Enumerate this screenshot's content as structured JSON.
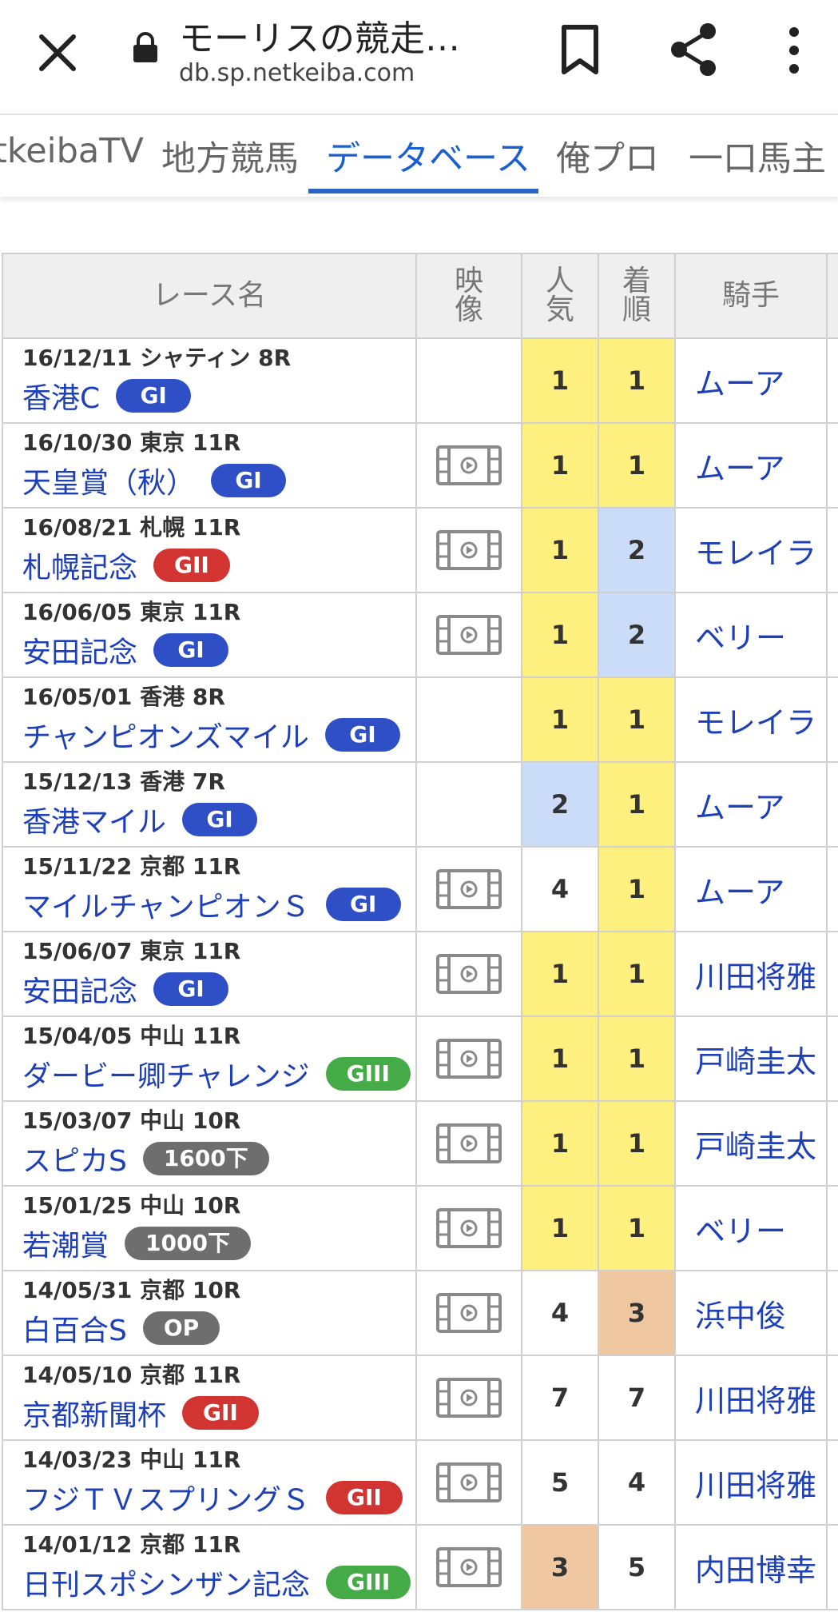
{
  "header": {
    "title": "モーリスの競走…",
    "url": "db.sp.netkeiba.com",
    "close_icon": "close-icon",
    "lock_icon": "lock-icon",
    "bookmark_icon": "bookmark-icon",
    "share_icon": "share-icon",
    "more_icon": "more-vert-icon"
  },
  "nav": {
    "tabs": [
      {
        "label": "tkeibaTV",
        "active": false
      },
      {
        "label": "地方競馬",
        "active": false
      },
      {
        "label": "データベース",
        "active": true
      },
      {
        "label": "俺プロ",
        "active": false
      },
      {
        "label": "一口馬主",
        "active": false
      }
    ]
  },
  "colors": {
    "link": "#1d3fb8",
    "tab_active": "#1a5fd0",
    "rank1_bg": "#fef07f",
    "rank2_bg": "#cbdcf8",
    "rank3_bg": "#efc8a2",
    "grade_GI": "#2f4fc7",
    "grade_GII": "#d23431",
    "grade_GIII": "#45ab47",
    "grade_other": "#6e6e6e"
  },
  "table": {
    "headers": {
      "race": "レース名",
      "video": "映像",
      "popularity": "人気",
      "finish": "着順",
      "jockey": "騎手"
    },
    "rows": [
      {
        "date": "16/12/11 シャティン 8R",
        "name": "香港C",
        "grade": "GI",
        "video": false,
        "pop": "1",
        "fin": "1",
        "jockey": "ムーア"
      },
      {
        "date": "16/10/30 東京 11R",
        "name": "天皇賞（秋）",
        "grade": "GI",
        "video": true,
        "pop": "1",
        "fin": "1",
        "jockey": "ムーア"
      },
      {
        "date": "16/08/21 札幌 11R",
        "name": "札幌記念",
        "grade": "GII",
        "video": true,
        "pop": "1",
        "fin": "2",
        "jockey": "モレイラ"
      },
      {
        "date": "16/06/05 東京 11R",
        "name": "安田記念",
        "grade": "GI",
        "video": true,
        "pop": "1",
        "fin": "2",
        "jockey": "ベリー"
      },
      {
        "date": "16/05/01 香港 8R",
        "name": "チャンピオンズマイル",
        "grade": "GI",
        "video": false,
        "pop": "1",
        "fin": "1",
        "jockey": "モレイラ"
      },
      {
        "date": "15/12/13 香港 7R",
        "name": "香港マイル",
        "grade": "GI",
        "video": false,
        "pop": "2",
        "fin": "1",
        "jockey": "ムーア"
      },
      {
        "date": "15/11/22 京都 11R",
        "name": "マイルチャンピオンＳ",
        "grade": "GI",
        "video": true,
        "pop": "4",
        "fin": "1",
        "jockey": "ムーア"
      },
      {
        "date": "15/06/07 東京 11R",
        "name": "安田記念",
        "grade": "GI",
        "video": true,
        "pop": "1",
        "fin": "1",
        "jockey": "川田将雅"
      },
      {
        "date": "15/04/05 中山 11R",
        "name": "ダービー卿チャレンジ",
        "grade": "GIII",
        "video": true,
        "pop": "1",
        "fin": "1",
        "jockey": "戸崎圭太"
      },
      {
        "date": "15/03/07 中山 10R",
        "name": "スピカS",
        "grade": "1600下",
        "video": true,
        "pop": "1",
        "fin": "1",
        "jockey": "戸崎圭太"
      },
      {
        "date": "15/01/25 中山 10R",
        "name": "若潮賞",
        "grade": "1000下",
        "video": true,
        "pop": "1",
        "fin": "1",
        "jockey": "ベリー"
      },
      {
        "date": "14/05/31 京都 10R",
        "name": "白百合S",
        "grade": "OP",
        "video": true,
        "pop": "4",
        "fin": "3",
        "jockey": "浜中俊"
      },
      {
        "date": "14/05/10 京都 11R",
        "name": "京都新聞杯",
        "grade": "GII",
        "video": true,
        "pop": "7",
        "fin": "7",
        "jockey": "川田将雅"
      },
      {
        "date": "14/03/23 中山 11R",
        "name": "フジＴＶスプリングＳ",
        "grade": "GII",
        "video": true,
        "pop": "5",
        "fin": "4",
        "jockey": "川田将雅"
      },
      {
        "date": "14/01/12 京都 11R",
        "name": "日刊スポシンザン記念",
        "grade": "GIII",
        "video": true,
        "pop": "3",
        "fin": "5",
        "jockey": "内田博幸"
      }
    ]
  }
}
